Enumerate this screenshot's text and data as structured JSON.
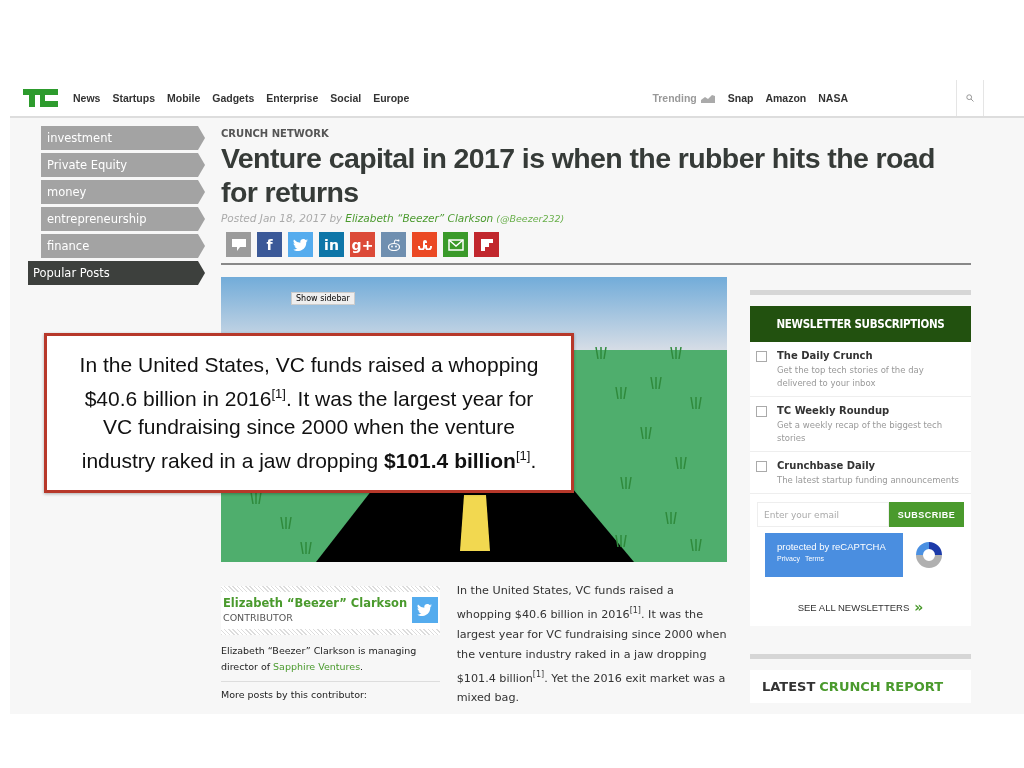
{
  "header": {
    "nav": [
      "News",
      "Startups",
      "Mobile",
      "Gadgets",
      "Enterprise",
      "Social",
      "Europe"
    ],
    "trending": {
      "label": "Trending",
      "topics": [
        "Snap",
        "Amazon",
        "NASA"
      ]
    }
  },
  "sidebar": {
    "tags": [
      "investment",
      "Private Equity",
      "money",
      "entrepreneurship",
      "finance"
    ],
    "popular": "Popular Posts"
  },
  "article": {
    "category": "CRUNCH NETWORK",
    "title": "Venture capital in 2017 is when the rubber hits the road for returns",
    "posted": "Posted Jan 18, 2017 by",
    "author": "Elizabeth “Beezer” Clarkson",
    "handle": "(@Beezer232)",
    "share": [
      {
        "kind": "comment",
        "color": "#9b9b9b"
      },
      {
        "kind": "letter",
        "label": "f",
        "color": "#3b5998"
      },
      {
        "kind": "bird",
        "color": "#55acee"
      },
      {
        "kind": "letter",
        "label": "in",
        "color": "#0e76a8"
      },
      {
        "kind": "letter",
        "label": "g+",
        "color": "#dc4a38"
      },
      {
        "kind": "alien",
        "color": "#6f8fb0"
      },
      {
        "kind": "su",
        "color": "#eb4924"
      },
      {
        "kind": "mail",
        "color": "#3a9a2a"
      },
      {
        "kind": "flip",
        "color": "#c1272d"
      }
    ],
    "image": {
      "show_sidebar": "Show sidebar"
    },
    "author_box": {
      "name": "Elizabeth “Beezer” Clarkson",
      "role": "CONTRIBUTOR",
      "bio_before": "Elizabeth “Beezer” Clarkson is managing director of",
      "bio_link": "Sapphire Ventures",
      "bio_after": ".",
      "more": "More posts by this contributor:"
    },
    "body": "In the United States, VC funds raised a whopping $40.6 billion in 2016$^{[1]}$. It was the largest year for VC fundraising since 2000 when the venture industry raked in a jaw dropping $101.4 billion$^{[1]}$. Yet the 2016 exit market was a mixed bag."
  },
  "newsletter": {
    "title": "NEWSLETTER SUBSCRIPTIONS",
    "items": [
      {
        "name": "The Daily Crunch",
        "description": "Get the top tech stories of the day delivered to your inbox",
        "checked": false
      },
      {
        "name": "TC Weekly Roundup",
        "description": "Get a weekly recap of the biggest tech stories",
        "checked": false
      },
      {
        "name": "Crunchbase Daily",
        "description": "The latest startup funding announcements",
        "checked": false
      }
    ],
    "email_placeholder": "Enter your email",
    "subscribe": "SUBSCRIBE",
    "recaptcha": {
      "label": "protected by reCAPTCHA",
      "links": [
        "Privacy",
        "Terms"
      ]
    },
    "see_all": "SEE ALL NEWSLETTERS",
    "see_all_arrow": "»"
  },
  "latest": {
    "first": "LATEST",
    "second": "CRUNCH REPORT"
  },
  "callout": "In the United States, VC funds raised a whopping $40.6 billion in 2016$^{[1]}$. It was the largest year for VC fundraising since 2000 when the venture industry raked in a jaw dropping **$101.4 billion**$^{[1]}$."
}
